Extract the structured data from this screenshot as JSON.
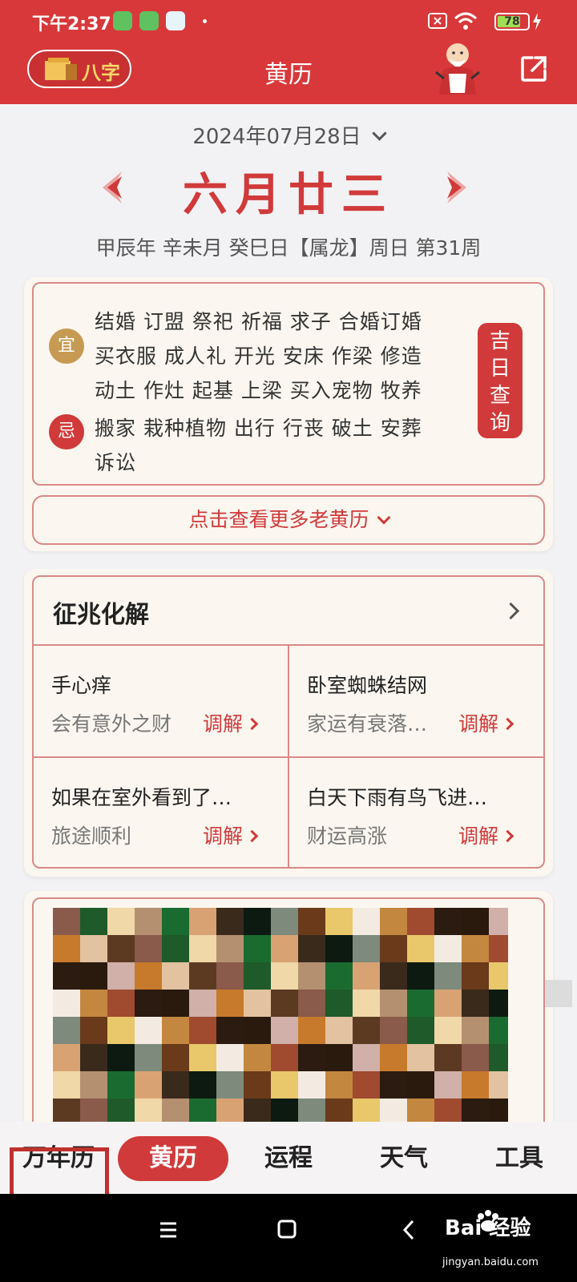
{
  "status_bar": {
    "time": "下午2:37",
    "battery_level": 78,
    "battery_text": "78",
    "icons": [
      "app-notification-icon",
      "app-notification-icon",
      "app-notification-icon",
      "sim-icon",
      "wifi-icon",
      "charging-icon"
    ]
  },
  "header": {
    "badge_label": "八字",
    "title": "黄历"
  },
  "date_picker": {
    "date": "2024年07月28日"
  },
  "lunar": {
    "day": "六月廿三",
    "ganzhi": "甲辰年 辛未月 癸巳日【属龙】周日 第31周"
  },
  "yiji": {
    "yi_label": "宜",
    "ji_label": "忌",
    "yi_lines": [
      "结婚 订盟 祭祀 祈福 求子 合婚订婚",
      "买衣服 成人礼 开光 安床 作梁 修造",
      "动土 作灶 起基 上梁 买入宠物 牧养"
    ],
    "ji_lines": [
      "搬家 栽种植物 出行 行丧 破土 安葬",
      "诉讼"
    ],
    "jiri_button": "吉日查询"
  },
  "more_button": "点击查看更多老黄历",
  "zhengzhao": {
    "title": "征兆化解",
    "items": [
      {
        "title": "手心痒",
        "desc": "会有意外之财",
        "action": "调解"
      },
      {
        "title": "卧室蜘蛛结网",
        "desc": "家运有衰落…",
        "action": "调解"
      },
      {
        "title": "如果在室外看到了…",
        "desc": "旅途顺利",
        "action": "调解"
      },
      {
        "title": "白天下雨有鸟飞进…",
        "desc": "财运高涨",
        "action": "调解"
      }
    ]
  },
  "tabs": [
    {
      "label": "万年历"
    },
    {
      "label": "黄历"
    },
    {
      "label": "运程"
    },
    {
      "label": "天气"
    },
    {
      "label": "工具"
    }
  ],
  "colors": {
    "brand_red": "#d8383a",
    "accent_red": "#d13a3a",
    "gold": "#c69a52"
  },
  "watermark": {
    "brand": "Bai 经验",
    "url": "jingyan.baidu.com"
  }
}
